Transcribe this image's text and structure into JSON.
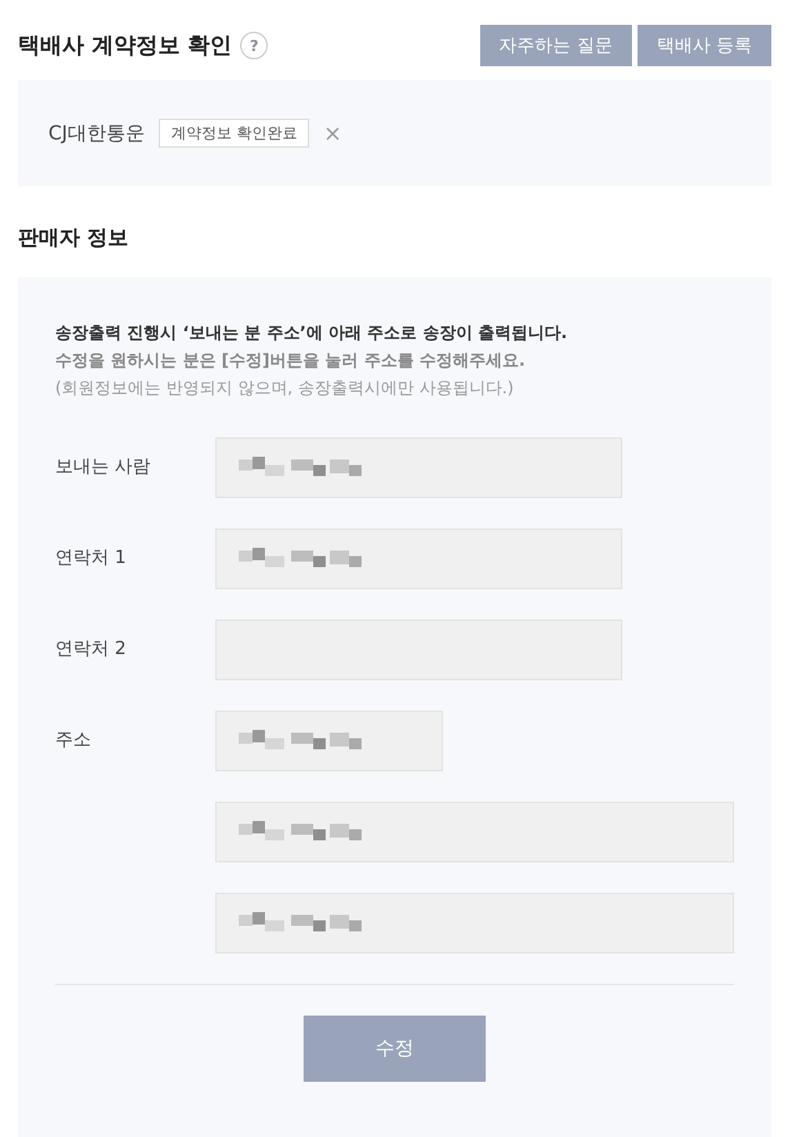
{
  "header": {
    "title": "택배사 계약정보 확인",
    "help_icon": "?",
    "buttons": [
      "자주하는 질문",
      "택배사 등록"
    ]
  },
  "contract": {
    "carrier": "CJ대한통운",
    "badge": "계약정보 확인완료",
    "remove": "×"
  },
  "seller": {
    "title": "판매자 정보",
    "notice": [
      "송장출력 진행시 ‘보내는 분 주소’에 아래 주소로 송장이 출력됩니다.",
      "수정을 원하시는 분은 [수정]버튼을 눌러 주소를 수정해주세요.",
      "(회원정보에는 반영되지 않으며, 송장출력시에만 사용됩니다.)"
    ],
    "rows": [
      {
        "label": "보내는 사람",
        "fields": [
          {
            "kind": "full",
            "redacted": true
          }
        ]
      },
      {
        "label": "연락처 1",
        "fields": [
          {
            "kind": "full",
            "redacted": true
          }
        ]
      },
      {
        "label": "연락처 2",
        "fields": [
          {
            "kind": "full",
            "redacted": false
          }
        ]
      },
      {
        "label": "주소",
        "fields": [
          {
            "kind": "short",
            "redacted": true
          },
          {
            "kind": "wide",
            "redacted": true
          },
          {
            "kind": "wide",
            "redacted": true
          }
        ]
      }
    ],
    "submit": "수정"
  }
}
